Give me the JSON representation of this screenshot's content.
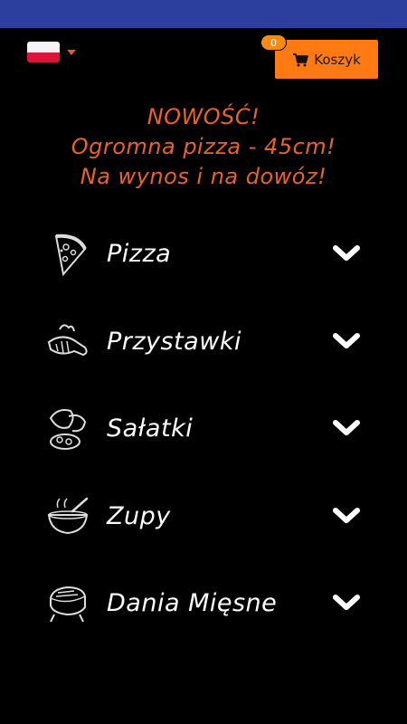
{
  "header": {
    "language": {
      "icon": "poland-flag-icon",
      "selected": "PL"
    },
    "cart": {
      "label": "Koszyk",
      "count": "0",
      "icon": "cart-icon",
      "accent_color": "#ff7a12"
    }
  },
  "promo": {
    "line1": "NOWOŚĆ!",
    "line2": "Ogromna pizza - 45cm!",
    "line3": "Na wynos i na dowóz!",
    "color": "#e8632c"
  },
  "menu": {
    "items": [
      {
        "label": "Pizza",
        "icon": "pizza-slice-icon"
      },
      {
        "label": "Przystawki",
        "icon": "appetizer-icon"
      },
      {
        "label": "Sałatki",
        "icon": "salad-icon"
      },
      {
        "label": "Zupy",
        "icon": "soup-bowl-icon"
      },
      {
        "label": "Dania Mięsne",
        "icon": "meat-dish-icon"
      }
    ]
  }
}
